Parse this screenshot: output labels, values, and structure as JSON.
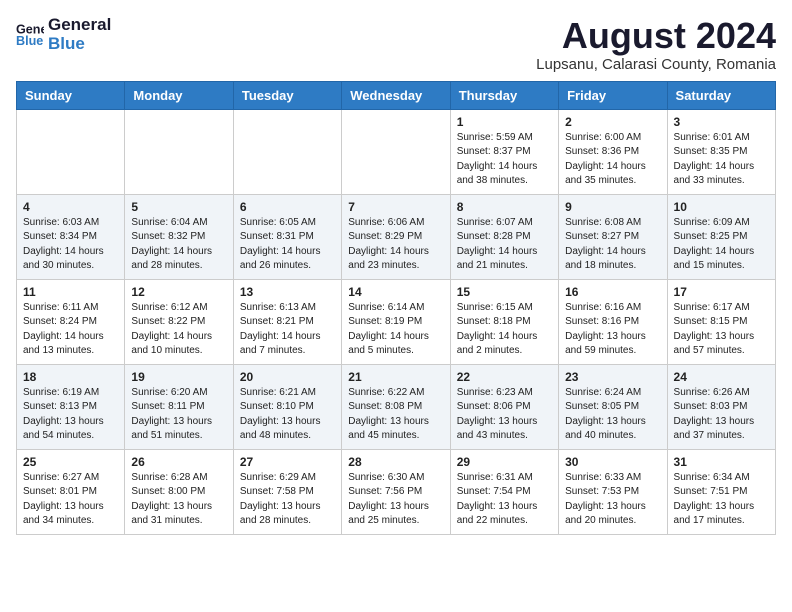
{
  "header": {
    "logo_line1": "General",
    "logo_line2": "Blue",
    "month_year": "August 2024",
    "location": "Lupsanu, Calarasi County, Romania"
  },
  "weekdays": [
    "Sunday",
    "Monday",
    "Tuesday",
    "Wednesday",
    "Thursday",
    "Friday",
    "Saturday"
  ],
  "weeks": [
    [
      {
        "day": "",
        "info": ""
      },
      {
        "day": "",
        "info": ""
      },
      {
        "day": "",
        "info": ""
      },
      {
        "day": "",
        "info": ""
      },
      {
        "day": "1",
        "info": "Sunrise: 5:59 AM\nSunset: 8:37 PM\nDaylight: 14 hours\nand 38 minutes."
      },
      {
        "day": "2",
        "info": "Sunrise: 6:00 AM\nSunset: 8:36 PM\nDaylight: 14 hours\nand 35 minutes."
      },
      {
        "day": "3",
        "info": "Sunrise: 6:01 AM\nSunset: 8:35 PM\nDaylight: 14 hours\nand 33 minutes."
      }
    ],
    [
      {
        "day": "4",
        "info": "Sunrise: 6:03 AM\nSunset: 8:34 PM\nDaylight: 14 hours\nand 30 minutes."
      },
      {
        "day": "5",
        "info": "Sunrise: 6:04 AM\nSunset: 8:32 PM\nDaylight: 14 hours\nand 28 minutes."
      },
      {
        "day": "6",
        "info": "Sunrise: 6:05 AM\nSunset: 8:31 PM\nDaylight: 14 hours\nand 26 minutes."
      },
      {
        "day": "7",
        "info": "Sunrise: 6:06 AM\nSunset: 8:29 PM\nDaylight: 14 hours\nand 23 minutes."
      },
      {
        "day": "8",
        "info": "Sunrise: 6:07 AM\nSunset: 8:28 PM\nDaylight: 14 hours\nand 21 minutes."
      },
      {
        "day": "9",
        "info": "Sunrise: 6:08 AM\nSunset: 8:27 PM\nDaylight: 14 hours\nand 18 minutes."
      },
      {
        "day": "10",
        "info": "Sunrise: 6:09 AM\nSunset: 8:25 PM\nDaylight: 14 hours\nand 15 minutes."
      }
    ],
    [
      {
        "day": "11",
        "info": "Sunrise: 6:11 AM\nSunset: 8:24 PM\nDaylight: 14 hours\nand 13 minutes."
      },
      {
        "day": "12",
        "info": "Sunrise: 6:12 AM\nSunset: 8:22 PM\nDaylight: 14 hours\nand 10 minutes."
      },
      {
        "day": "13",
        "info": "Sunrise: 6:13 AM\nSunset: 8:21 PM\nDaylight: 14 hours\nand 7 minutes."
      },
      {
        "day": "14",
        "info": "Sunrise: 6:14 AM\nSunset: 8:19 PM\nDaylight: 14 hours\nand 5 minutes."
      },
      {
        "day": "15",
        "info": "Sunrise: 6:15 AM\nSunset: 8:18 PM\nDaylight: 14 hours\nand 2 minutes."
      },
      {
        "day": "16",
        "info": "Sunrise: 6:16 AM\nSunset: 8:16 PM\nDaylight: 13 hours\nand 59 minutes."
      },
      {
        "day": "17",
        "info": "Sunrise: 6:17 AM\nSunset: 8:15 PM\nDaylight: 13 hours\nand 57 minutes."
      }
    ],
    [
      {
        "day": "18",
        "info": "Sunrise: 6:19 AM\nSunset: 8:13 PM\nDaylight: 13 hours\nand 54 minutes."
      },
      {
        "day": "19",
        "info": "Sunrise: 6:20 AM\nSunset: 8:11 PM\nDaylight: 13 hours\nand 51 minutes."
      },
      {
        "day": "20",
        "info": "Sunrise: 6:21 AM\nSunset: 8:10 PM\nDaylight: 13 hours\nand 48 minutes."
      },
      {
        "day": "21",
        "info": "Sunrise: 6:22 AM\nSunset: 8:08 PM\nDaylight: 13 hours\nand 45 minutes."
      },
      {
        "day": "22",
        "info": "Sunrise: 6:23 AM\nSunset: 8:06 PM\nDaylight: 13 hours\nand 43 minutes."
      },
      {
        "day": "23",
        "info": "Sunrise: 6:24 AM\nSunset: 8:05 PM\nDaylight: 13 hours\nand 40 minutes."
      },
      {
        "day": "24",
        "info": "Sunrise: 6:26 AM\nSunset: 8:03 PM\nDaylight: 13 hours\nand 37 minutes."
      }
    ],
    [
      {
        "day": "25",
        "info": "Sunrise: 6:27 AM\nSunset: 8:01 PM\nDaylight: 13 hours\nand 34 minutes."
      },
      {
        "day": "26",
        "info": "Sunrise: 6:28 AM\nSunset: 8:00 PM\nDaylight: 13 hours\nand 31 minutes."
      },
      {
        "day": "27",
        "info": "Sunrise: 6:29 AM\nSunset: 7:58 PM\nDaylight: 13 hours\nand 28 minutes."
      },
      {
        "day": "28",
        "info": "Sunrise: 6:30 AM\nSunset: 7:56 PM\nDaylight: 13 hours\nand 25 minutes."
      },
      {
        "day": "29",
        "info": "Sunrise: 6:31 AM\nSunset: 7:54 PM\nDaylight: 13 hours\nand 22 minutes."
      },
      {
        "day": "30",
        "info": "Sunrise: 6:33 AM\nSunset: 7:53 PM\nDaylight: 13 hours\nand 20 minutes."
      },
      {
        "day": "31",
        "info": "Sunrise: 6:34 AM\nSunset: 7:51 PM\nDaylight: 13 hours\nand 17 minutes."
      }
    ]
  ]
}
